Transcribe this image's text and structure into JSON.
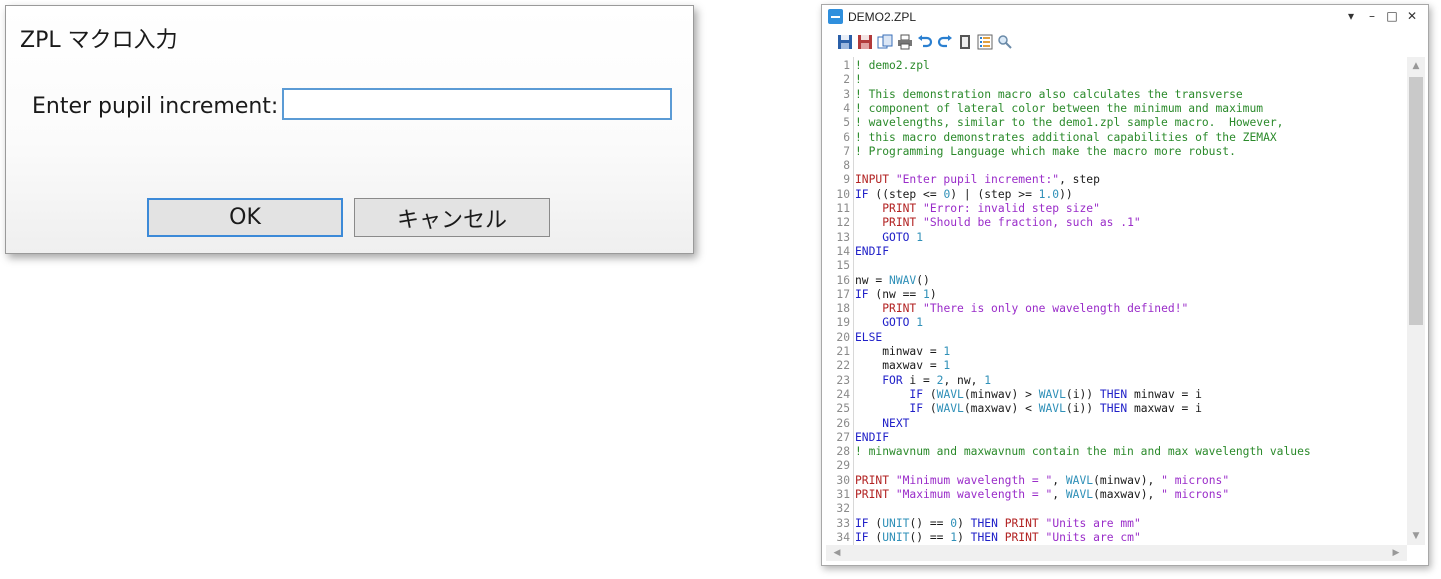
{
  "dialog": {
    "title": "ZPL マクロ入力",
    "prompt_label": "Enter pupil increment:",
    "input_value": "",
    "ok_label": "OK",
    "cancel_label": "キャンセル"
  },
  "editor_window": {
    "title": "DEMO2.ZPL",
    "controls": {
      "dropdown": "▾",
      "minimize": "–",
      "maximize": "□",
      "close": "✕"
    },
    "toolbar_icons": [
      "save-icon",
      "save-all-icon",
      "copy-icon",
      "print-icon",
      "undo-icon",
      "redo-icon",
      "page-icon",
      "list-icon",
      "find-icon"
    ],
    "lines": [
      {
        "n": "1",
        "t": [
          [
            "c",
            "! demo2.zpl"
          ]
        ]
      },
      {
        "n": "2",
        "t": [
          [
            "c",
            "!"
          ]
        ]
      },
      {
        "n": "3",
        "t": [
          [
            "c",
            "! This demonstration macro also calculates the transverse"
          ]
        ]
      },
      {
        "n": "4",
        "t": [
          [
            "c",
            "! component of lateral color between the minimum and maximum"
          ]
        ]
      },
      {
        "n": "5",
        "t": [
          [
            "c",
            "! wavelengths, similar to the demo1.zpl sample macro.  However,"
          ]
        ]
      },
      {
        "n": "6",
        "t": [
          [
            "c",
            "! this macro demonstrates additional capabilities of the ZEMAX"
          ]
        ]
      },
      {
        "n": "7",
        "t": [
          [
            "c",
            "! Programming Language which make the macro more robust."
          ]
        ]
      },
      {
        "n": "8",
        "t": []
      },
      {
        "n": "9",
        "t": [
          [
            "k1",
            "INPUT"
          ],
          [
            "p",
            " "
          ],
          [
            "s",
            "\"Enter pupil increment:\""
          ],
          [
            "p",
            ", step"
          ]
        ]
      },
      {
        "n": "10",
        "t": [
          [
            "k2",
            "IF"
          ],
          [
            "p",
            " ((step <= "
          ],
          [
            "n",
            "0"
          ],
          [
            "p",
            ") | (step >= "
          ],
          [
            "n",
            "1.0"
          ],
          [
            "p",
            "))"
          ]
        ]
      },
      {
        "n": "11",
        "t": [
          [
            "p",
            "    "
          ],
          [
            "k1",
            "PRINT"
          ],
          [
            "p",
            " "
          ],
          [
            "s",
            "\"Error: invalid step size\""
          ]
        ]
      },
      {
        "n": "12",
        "t": [
          [
            "p",
            "    "
          ],
          [
            "k1",
            "PRINT"
          ],
          [
            "p",
            " "
          ],
          [
            "s",
            "\"Should be fraction, such as .1\""
          ]
        ]
      },
      {
        "n": "13",
        "t": [
          [
            "p",
            "    "
          ],
          [
            "k2",
            "GOTO"
          ],
          [
            "p",
            " "
          ],
          [
            "n",
            "1"
          ]
        ]
      },
      {
        "n": "14",
        "t": [
          [
            "k2",
            "ENDIF"
          ]
        ]
      },
      {
        "n": "15",
        "t": []
      },
      {
        "n": "16",
        "t": [
          [
            "p",
            "nw = "
          ],
          [
            "f",
            "NWAV"
          ],
          [
            "p",
            "()"
          ]
        ]
      },
      {
        "n": "17",
        "t": [
          [
            "k2",
            "IF"
          ],
          [
            "p",
            " (nw == "
          ],
          [
            "n",
            "1"
          ],
          [
            "p",
            ")"
          ]
        ]
      },
      {
        "n": "18",
        "t": [
          [
            "p",
            "    "
          ],
          [
            "k1",
            "PRINT"
          ],
          [
            "p",
            " "
          ],
          [
            "s",
            "\"There is only one wavelength defined!\""
          ]
        ]
      },
      {
        "n": "19",
        "t": [
          [
            "p",
            "    "
          ],
          [
            "k2",
            "GOTO"
          ],
          [
            "p",
            " "
          ],
          [
            "n",
            "1"
          ]
        ]
      },
      {
        "n": "20",
        "t": [
          [
            "k2",
            "ELSE"
          ]
        ]
      },
      {
        "n": "21",
        "t": [
          [
            "p",
            "    minwav = "
          ],
          [
            "n",
            "1"
          ]
        ]
      },
      {
        "n": "22",
        "t": [
          [
            "p",
            "    maxwav = "
          ],
          [
            "n",
            "1"
          ]
        ]
      },
      {
        "n": "23",
        "t": [
          [
            "p",
            "    "
          ],
          [
            "k2",
            "FOR"
          ],
          [
            "p",
            " i = "
          ],
          [
            "n",
            "2"
          ],
          [
            "p",
            ", nw, "
          ],
          [
            "n",
            "1"
          ]
        ]
      },
      {
        "n": "24",
        "t": [
          [
            "p",
            "        "
          ],
          [
            "k2",
            "IF"
          ],
          [
            "p",
            " ("
          ],
          [
            "f",
            "WAVL"
          ],
          [
            "p",
            "(minwav) > "
          ],
          [
            "f",
            "WAVL"
          ],
          [
            "p",
            "(i)) "
          ],
          [
            "k2",
            "THEN"
          ],
          [
            "p",
            " minwav = i"
          ]
        ]
      },
      {
        "n": "25",
        "t": [
          [
            "p",
            "        "
          ],
          [
            "k2",
            "IF"
          ],
          [
            "p",
            " ("
          ],
          [
            "f",
            "WAVL"
          ],
          [
            "p",
            "(maxwav) < "
          ],
          [
            "f",
            "WAVL"
          ],
          [
            "p",
            "(i)) "
          ],
          [
            "k2",
            "THEN"
          ],
          [
            "p",
            " maxwav = i"
          ]
        ]
      },
      {
        "n": "26",
        "t": [
          [
            "p",
            "    "
          ],
          [
            "k2",
            "NEXT"
          ]
        ]
      },
      {
        "n": "27",
        "t": [
          [
            "k2",
            "ENDIF"
          ]
        ]
      },
      {
        "n": "28",
        "t": [
          [
            "c",
            "! minwavnum and maxwavnum contain the min and max wavelength values"
          ]
        ]
      },
      {
        "n": "29",
        "t": []
      },
      {
        "n": "30",
        "t": [
          [
            "k1",
            "PRINT"
          ],
          [
            "p",
            " "
          ],
          [
            "s",
            "\"Minimum wavelength = \""
          ],
          [
            "p",
            ", "
          ],
          [
            "f",
            "WAVL"
          ],
          [
            "p",
            "(minwav), "
          ],
          [
            "s",
            "\" microns\""
          ]
        ]
      },
      {
        "n": "31",
        "t": [
          [
            "k1",
            "PRINT"
          ],
          [
            "p",
            " "
          ],
          [
            "s",
            "\"Maximum wavelength = \""
          ],
          [
            "p",
            ", "
          ],
          [
            "f",
            "WAVL"
          ],
          [
            "p",
            "(maxwav), "
          ],
          [
            "s",
            "\" microns\""
          ]
        ]
      },
      {
        "n": "32",
        "t": []
      },
      {
        "n": "33",
        "t": [
          [
            "k2",
            "IF"
          ],
          [
            "p",
            " ("
          ],
          [
            "f",
            "UNIT"
          ],
          [
            "p",
            "() == "
          ],
          [
            "n",
            "0"
          ],
          [
            "p",
            ") "
          ],
          [
            "k2",
            "THEN"
          ],
          [
            "p",
            " "
          ],
          [
            "k1",
            "PRINT"
          ],
          [
            "p",
            " "
          ],
          [
            "s",
            "\"Units are mm\""
          ]
        ]
      },
      {
        "n": "34",
        "t": [
          [
            "k2",
            "IF"
          ],
          [
            "p",
            " ("
          ],
          [
            "f",
            "UNIT"
          ],
          [
            "p",
            "() == "
          ],
          [
            "n",
            "1"
          ],
          [
            "p",
            ") "
          ],
          [
            "k2",
            "THEN"
          ],
          [
            "p",
            " "
          ],
          [
            "k1",
            "PRINT"
          ],
          [
            "p",
            " "
          ],
          [
            "s",
            "\"Units are cm\""
          ]
        ]
      }
    ]
  }
}
